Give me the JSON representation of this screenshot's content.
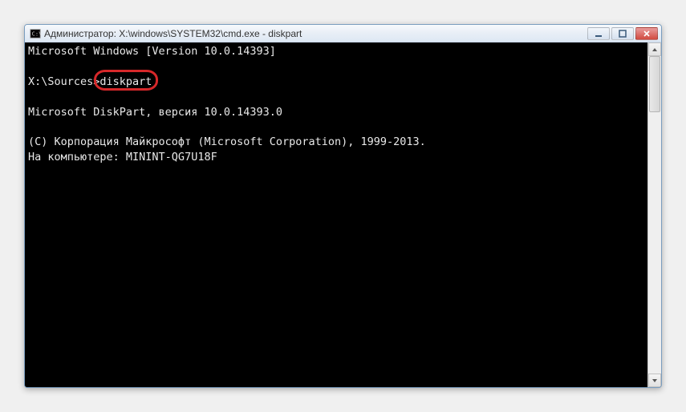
{
  "window": {
    "title": "Администратор: X:\\windows\\SYSTEM32\\cmd.exe - diskpart"
  },
  "terminal": {
    "line1": "Microsoft Windows [Version 10.0.14393]",
    "blank": "",
    "prompt_prefix": "X:\\Sources>",
    "prompt_command": "diskpart",
    "line3": "Microsoft DiskPart, версия 10.0.14393.0",
    "line4": "(C) Корпорация Майкрософт (Microsoft Corporation), 1999-2013.",
    "line5": "На компьютере: MININT-QG7U18F"
  },
  "highlight": {
    "target": "diskpart"
  }
}
